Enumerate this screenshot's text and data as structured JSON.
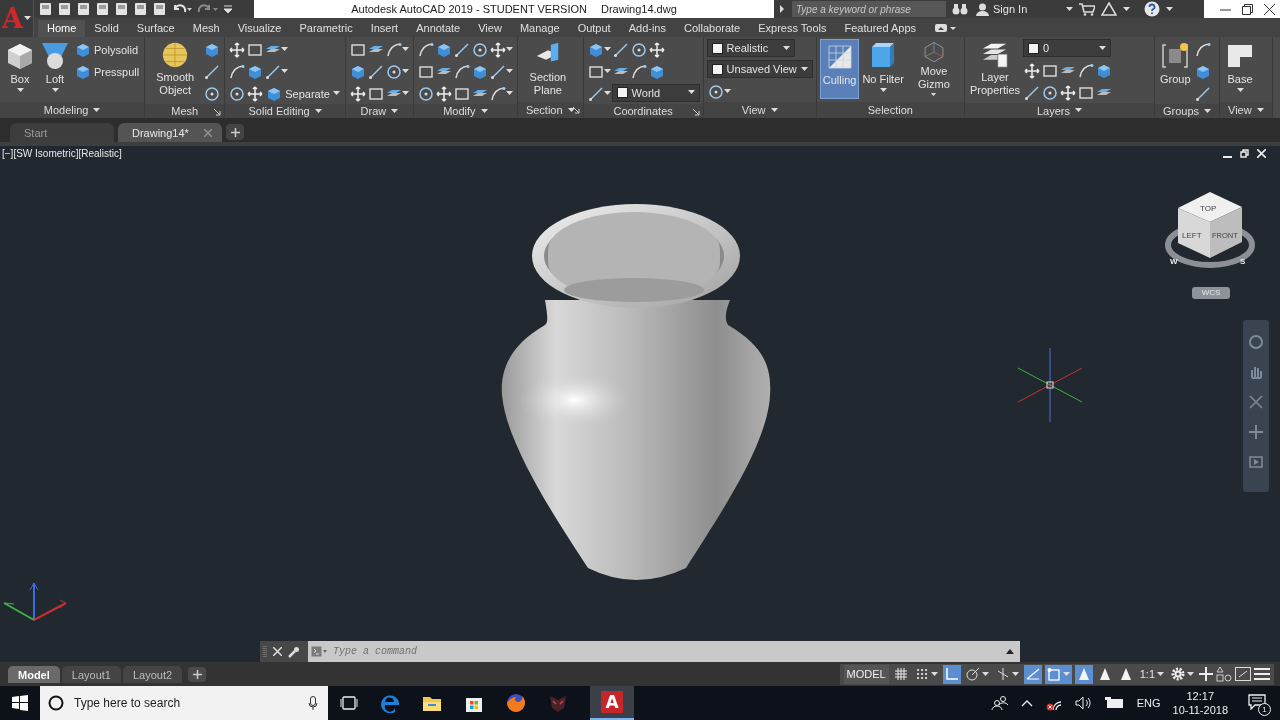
{
  "app": {
    "logo": "A"
  },
  "title_bar": {
    "title": "Autodesk AutoCAD 2019 - STUDENT VERSION",
    "document": "Drawing14.dwg",
    "search": {
      "placeholder": "Type a keyword or phrase"
    },
    "sign_in": "Sign In"
  },
  "ribbon_tabs": [
    {
      "label": "Home",
      "selected": true
    },
    {
      "label": "Solid",
      "selected": false
    },
    {
      "label": "Surface",
      "selected": false
    },
    {
      "label": "Mesh",
      "selected": false
    },
    {
      "label": "Visualize",
      "selected": false
    },
    {
      "label": "Parametric",
      "selected": false
    },
    {
      "label": "Insert",
      "selected": false
    },
    {
      "label": "Annotate",
      "selected": false
    },
    {
      "label": "View",
      "selected": false
    },
    {
      "label": "Manage",
      "selected": false
    },
    {
      "label": "Output",
      "selected": false
    },
    {
      "label": "Add-ins",
      "selected": false
    },
    {
      "label": "Collaborate",
      "selected": false
    },
    {
      "label": "Express Tools",
      "selected": false
    },
    {
      "label": "Featured Apps",
      "selected": false
    }
  ],
  "ribbon_panels": [
    {
      "title": "Modeling",
      "menu": true,
      "launcher": false,
      "columns": [
        [
          {
            "kind": "large",
            "label": "Box",
            "menu": true,
            "on": false
          }
        ],
        [
          {
            "kind": "large",
            "label": "Loft",
            "menu": true,
            "on": false
          }
        ],
        [
          {
            "kind": "small",
            "label": "Polysolid",
            "menu": false
          },
          {
            "kind": "small",
            "label": "Presspull",
            "menu": false
          }
        ]
      ]
    },
    {
      "title": "Mesh",
      "menu": false,
      "launcher": true,
      "columns": [
        [
          {
            "kind": "large",
            "label": "Smooth Object",
            "menu": false,
            "on": false
          }
        ],
        [
          {
            "kind": "tool",
            "menu": false
          },
          {
            "kind": "tool",
            "menu": false
          },
          {
            "kind": "tool",
            "menu": false
          }
        ]
      ]
    },
    {
      "title": "Solid Editing",
      "menu": true,
      "launcher": false,
      "columns": [
        [
          {
            "kind": "row",
            "items": [
              {
                "kind": "tool",
                "menu": false
              },
              {
                "kind": "tool",
                "menu": false
              },
              {
                "kind": "tool",
                "menu": true
              }
            ]
          },
          {
            "kind": "row",
            "items": [
              {
                "kind": "tool",
                "menu": false
              },
              {
                "kind": "tool",
                "menu": false
              },
              {
                "kind": "tool",
                "menu": true
              }
            ]
          },
          {
            "kind": "row",
            "items": [
              {
                "kind": "tool",
                "menu": false
              },
              {
                "kind": "tool",
                "menu": false
              },
              {
                "kind": "small",
                "label": "Separate",
                "menu": true
              }
            ]
          }
        ]
      ]
    },
    {
      "title": "Draw",
      "menu": true,
      "launcher": false,
      "columns": [
        [
          {
            "kind": "row",
            "items": [
              {
                "kind": "tool",
                "menu": false
              },
              {
                "kind": "tool",
                "menu": false
              },
              {
                "kind": "tool",
                "menu": true
              }
            ]
          },
          {
            "kind": "row",
            "items": [
              {
                "kind": "tool",
                "menu": false
              },
              {
                "kind": "tool",
                "menu": false
              },
              {
                "kind": "tool",
                "menu": true
              }
            ]
          },
          {
            "kind": "row",
            "items": [
              {
                "kind": "tool",
                "menu": false
              },
              {
                "kind": "tool",
                "menu": false
              },
              {
                "kind": "tool",
                "menu": true
              }
            ]
          }
        ]
      ]
    },
    {
      "title": "Modify",
      "menu": true,
      "launcher": false,
      "columns": [
        [
          {
            "kind": "row",
            "items": [
              {
                "kind": "tool",
                "menu": false
              },
              {
                "kind": "tool",
                "menu": false
              },
              {
                "kind": "tool",
                "menu": false
              },
              {
                "kind": "tool",
                "menu": false
              },
              {
                "kind": "tool",
                "menu": true
              }
            ]
          },
          {
            "kind": "row",
            "items": [
              {
                "kind": "tool",
                "menu": false
              },
              {
                "kind": "tool",
                "menu": false
              },
              {
                "kind": "tool",
                "menu": false
              },
              {
                "kind": "tool",
                "menu": false
              },
              {
                "kind": "tool",
                "menu": true
              }
            ]
          },
          {
            "kind": "row",
            "items": [
              {
                "kind": "tool",
                "menu": false
              },
              {
                "kind": "tool",
                "menu": false
              },
              {
                "kind": "tool",
                "menu": false
              },
              {
                "kind": "tool",
                "menu": false
              },
              {
                "kind": "tool",
                "menu": true
              }
            ]
          }
        ]
      ]
    },
    {
      "title": "Section",
      "menu": true,
      "launcher": true,
      "columns": [
        [
          {
            "kind": "large",
            "label": "Section Plane",
            "menu": false,
            "on": false
          }
        ]
      ]
    },
    {
      "title": "Coordinates",
      "menu": false,
      "launcher": true,
      "columns": [
        [
          {
            "kind": "row",
            "items": [
              {
                "kind": "tool",
                "menu": true
              },
              {
                "kind": "tool",
                "menu": false
              },
              {
                "kind": "tool",
                "menu": false
              },
              {
                "kind": "tool",
                "menu": false
              }
            ]
          },
          {
            "kind": "row",
            "items": [
              {
                "kind": "tool",
                "menu": true
              },
              {
                "kind": "tool",
                "menu": false
              },
              {
                "kind": "tool",
                "menu": false
              },
              {
                "kind": "tool",
                "menu": false
              }
            ]
          },
          {
            "kind": "row",
            "items": [
              {
                "kind": "tool",
                "menu": true
              },
              {
                "kind": "dropdown",
                "value": "World"
              }
            ]
          }
        ]
      ]
    },
    {
      "title": "View",
      "menu": true,
      "launcher": false,
      "columns": [
        [
          {
            "kind": "dropdown",
            "value": "Realistic"
          },
          {
            "kind": "dropdown",
            "value": "Unsaved View"
          },
          {
            "kind": "tool",
            "menu": true
          }
        ]
      ]
    },
    {
      "title": "Selection",
      "menu": false,
      "launcher": false,
      "columns": [
        [
          {
            "kind": "large",
            "label": "Culling",
            "menu": false,
            "on": true
          }
        ],
        [
          {
            "kind": "large",
            "label": "No Filter",
            "menu": true,
            "on": false
          }
        ],
        [
          {
            "kind": "large",
            "label": "Move Gizmo",
            "menu": true,
            "on": false
          }
        ]
      ]
    },
    {
      "title": "Layers",
      "menu": true,
      "launcher": false,
      "columns": [
        [
          {
            "kind": "large",
            "label": "Layer Properties",
            "menu": false,
            "on": false
          }
        ],
        [
          {
            "kind": "dropdown",
            "value": "0"
          },
          {
            "kind": "row",
            "items": [
              {
                "kind": "tool",
                "menu": false
              },
              {
                "kind": "tool",
                "menu": false
              },
              {
                "kind": "tool",
                "menu": false
              },
              {
                "kind": "tool",
                "menu": false
              },
              {
                "kind": "tool",
                "menu": false
              }
            ]
          },
          {
            "kind": "row",
            "items": [
              {
                "kind": "tool",
                "menu": false
              },
              {
                "kind": "tool",
                "menu": false
              },
              {
                "kind": "tool",
                "menu": false
              },
              {
                "kind": "tool",
                "menu": false
              },
              {
                "kind": "tool",
                "menu": false
              }
            ]
          }
        ]
      ]
    },
    {
      "title": "Groups",
      "menu": true,
      "launcher": false,
      "columns": [
        [
          {
            "kind": "large",
            "label": "Group",
            "menu": false,
            "on": false
          }
        ],
        [
          {
            "kind": "tool",
            "menu": false
          },
          {
            "kind": "tool",
            "menu": false
          },
          {
            "kind": "tool",
            "menu": false
          }
        ]
      ]
    },
    {
      "title": "View",
      "menu": true,
      "launcher": false,
      "columns": [
        [
          {
            "kind": "large",
            "label": "Base",
            "menu": true,
            "on": false
          }
        ]
      ]
    }
  ],
  "document_tabs": [
    {
      "label": "Start",
      "selected": false,
      "closable": false
    },
    {
      "label": "Drawing14*",
      "selected": true,
      "closable": true
    }
  ],
  "viewport": {
    "controls": [
      "[−]",
      "[SW Isometric]",
      "[Realistic]"
    ],
    "viewcube": {
      "faces": [
        "TOP",
        "LEFT",
        "FRONT"
      ],
      "compass": [
        "W",
        "S"
      ],
      "coordinate_system": "WCS"
    }
  },
  "command_line": {
    "placeholder": "Type a command"
  },
  "layout_tabs": [
    {
      "label": "Model",
      "selected": true
    },
    {
      "label": "Layout1",
      "selected": false
    },
    {
      "label": "Layout2",
      "selected": false
    }
  ],
  "status_bar": {
    "space": "MODEL",
    "toggles": [
      {
        "kind": "grid",
        "on": false,
        "menu": false
      },
      {
        "kind": "snap",
        "on": false,
        "menu": true
      },
      {
        "kind": "ortho",
        "on": true,
        "menu": false
      },
      {
        "kind": "polar",
        "on": false,
        "menu": true
      },
      {
        "kind": "isodraft",
        "on": false,
        "menu": true
      },
      {
        "kind": "tracking",
        "on": true,
        "menu": false
      },
      {
        "kind": "osnap",
        "on": true,
        "menu": true
      },
      {
        "kind": "annovisible",
        "on": true,
        "menu": false
      },
      {
        "kind": "autoscale",
        "on": false,
        "menu": false
      },
      {
        "kind": "annoscale",
        "on": false,
        "menu": false
      }
    ],
    "scale": "1:1"
  },
  "taskbar": {
    "app_icon": "A",
    "search": {
      "placeholder": "Type here to search"
    },
    "language": "ENG",
    "time": "12:17",
    "date": "10-11-2018",
    "notifications": "1"
  }
}
